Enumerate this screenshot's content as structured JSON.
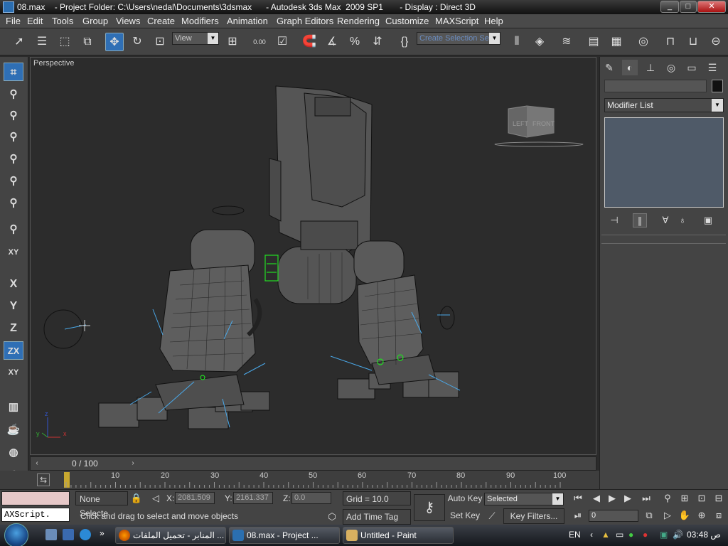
{
  "window": {
    "title": "08.max    - Project Folder: C:\\Users\\nedal\\Documents\\3dsmax      - Autodesk 3ds Max  2009 SP1       - Display : Direct 3D",
    "minimize": "_",
    "maximize": "□",
    "close": "✕"
  },
  "menu": [
    "File",
    "Edit",
    "Tools",
    "Group",
    "Views",
    "Create",
    "Modifiers",
    "Animation",
    "Graph Editors",
    "Rendering",
    "Customize",
    "MAXScript",
    "Help"
  ],
  "toolbar": {
    "ref_coord": "View",
    "selection_set_placeholder": "Create Selection Set",
    "spinner_label": "0.00"
  },
  "left_toolbar": {
    "axis_x": "X",
    "axis_y": "Y",
    "axis_z": "Z",
    "axis_zx": "ZX",
    "axis_xy": "XY",
    "axis_xy2": "XY"
  },
  "viewport": {
    "label": "Perspective",
    "viewcube_left": "LEFT",
    "viewcube_front": "FRONT",
    "axis_x": "x",
    "axis_y": "y",
    "axis_z": "z"
  },
  "command_panel": {
    "modifier_list": "Modifier List"
  },
  "time_slider": {
    "frame": "0 / 100"
  },
  "track_bar": {
    "ticks": [
      "10",
      "20",
      "30",
      "40",
      "50",
      "60",
      "70",
      "80",
      "90",
      "100"
    ]
  },
  "status": {
    "selection": "None Selecte",
    "maxscript": "AXScript.",
    "prompt": "Click and drag to select and move objects",
    "x_label": "X:",
    "x_value": "2081.509",
    "y_label": "Y:",
    "y_value": "2161.337",
    "z_label": "Z:",
    "z_value": "0.0",
    "grid": "Grid = 10.0",
    "add_time_tag": "Add Time Tag",
    "auto_key": "Auto Key",
    "set_key": "Set Key",
    "key_mode": "Selected",
    "key_filters": "Key Filters...",
    "current_frame": "0"
  },
  "taskbar": {
    "tasks": [
      "المنابر - تحميل الملفات ...",
      "08.max    - Project ...",
      "Untitled - Paint"
    ],
    "lang": "EN",
    "clock": "03:48 ص"
  },
  "colors": {
    "accent": "#2f6fb5",
    "viewport_bg": "#2c2c2c",
    "panel_bg": "#444444",
    "wire_green": "#22dd22",
    "light_blue": "#4aa8e8"
  }
}
